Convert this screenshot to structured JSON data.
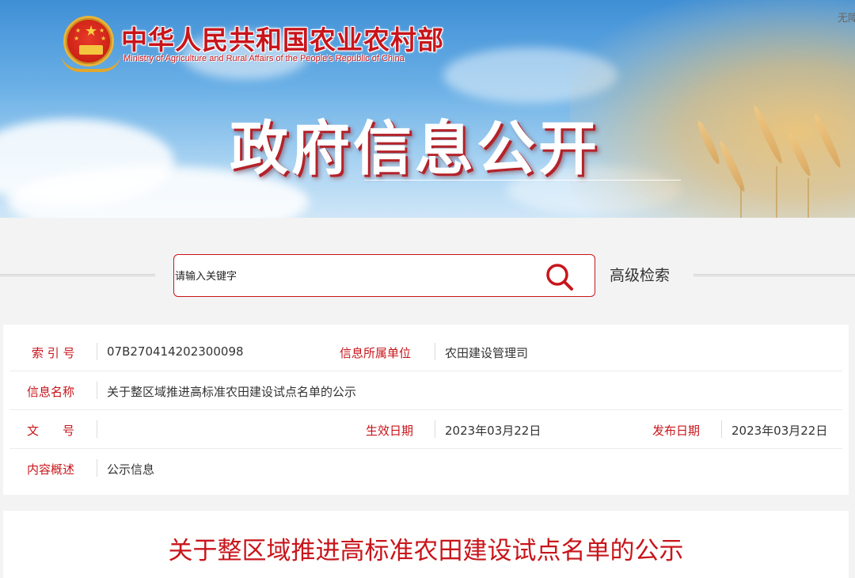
{
  "header": {
    "ministry_cn": "中华人民共和国农业农村部",
    "ministry_en": "Ministry of Agriculture and Rural Affairs of the People's Republic of China",
    "top_link": "无障",
    "banner_title": "政府信息公开"
  },
  "search": {
    "placeholder": "请输入关键字",
    "advanced_label": "高级检索"
  },
  "info": {
    "index_label": "索 引 号",
    "index_value": "07B270414202300098",
    "unit_label": "信息所属单位",
    "unit_value": "农田建设管理司",
    "name_label": "信息名称",
    "name_value": "关于整区域推进高标准农田建设试点名单的公示",
    "doc_label": "文　　号",
    "doc_value": "",
    "effective_label": "生效日期",
    "effective_value": "2023年03月22日",
    "publish_label": "发布日期",
    "publish_value": "2023年03月22日",
    "summary_label": "内容概述",
    "summary_value": "公示信息"
  },
  "article": {
    "title": "关于整区域推进高标准农田建设试点名单的公示"
  },
  "colors": {
    "accent_red": "#c8151b",
    "text": "#333333",
    "page_bg": "#f3f3f3"
  },
  "icons": [
    "national-emblem-icon",
    "search-icon"
  ]
}
